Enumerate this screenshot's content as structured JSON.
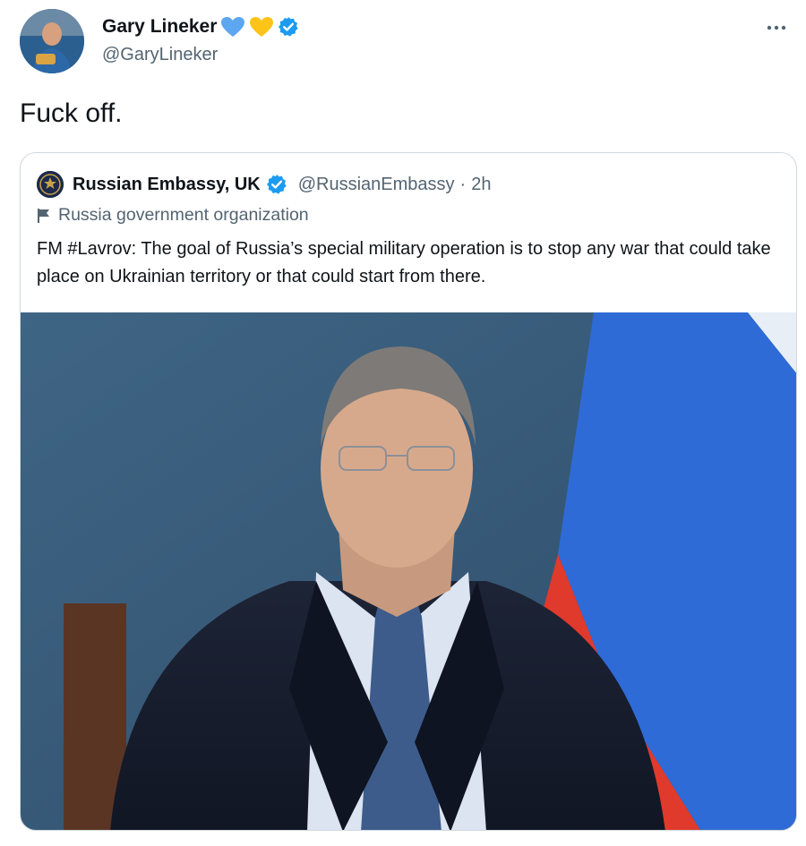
{
  "tweet": {
    "author": {
      "display_name": "Gary Lineker",
      "handle": "@GaryLineker",
      "heart_colors": [
        "#5da7f0",
        "#fcc419"
      ],
      "verified_icon": "verified-badge-icon"
    },
    "more_icon": "more-horizontal-icon",
    "text": "Fuck off."
  },
  "quoted": {
    "author": {
      "display_name": "Russian Embassy, UK",
      "handle": "@RussianEmbassy",
      "separator": "·",
      "time": "2h",
      "verified_icon": "verified-badge-icon"
    },
    "label_icon": "flag-icon",
    "label": "Russia government organization",
    "text": "FM #Lavrov: The goal of Russia’s special military operation is to stop any war that could take place on Ukrainian territory or that could start from there.",
    "media_icon": "photo-image"
  },
  "colors": {
    "verified": "#1d9bf0",
    "text_secondary": "#536471",
    "border": "#cfd9de"
  }
}
